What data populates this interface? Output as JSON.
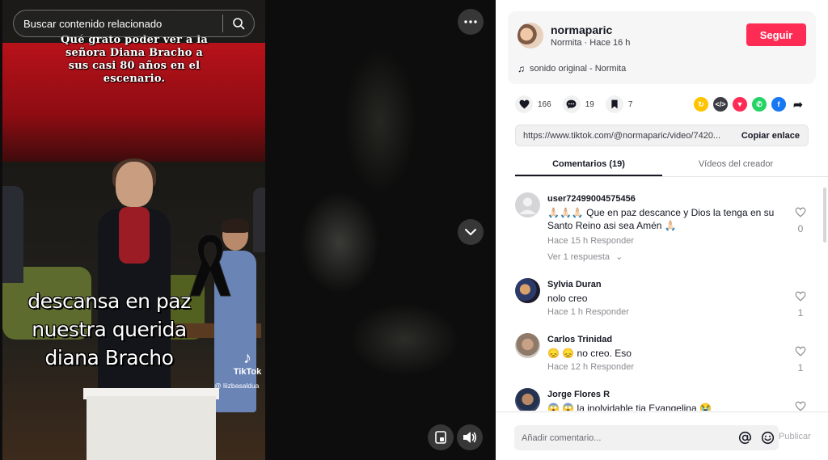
{
  "video": {
    "search_placeholder": "Buscar contenido relacionado",
    "caption_top": "Qué grato poder ver a la señora Diana Bracho a sus casi 80 años en el escenario.",
    "caption_main": "descansa en paz nuestra querida diana Bracho",
    "watermark_brand": "TikTok",
    "watermark_user": "@ liizbasaldua"
  },
  "creator": {
    "username": "normaparic",
    "subtitle": "Normita · Hace 16 h",
    "follow_label": "Seguir",
    "sound": "sonido original - Normita"
  },
  "actions": {
    "likes": "166",
    "comments": "19",
    "saves": "7"
  },
  "link": {
    "url": "https://www.tiktok.com/@normaparic/video/7420...",
    "copy_label": "Copiar enlace"
  },
  "tabs": [
    {
      "label": "Comentarios (19)"
    },
    {
      "label": "Vídeos del creador"
    }
  ],
  "comments": [
    {
      "user": "user72499004575456",
      "text": "🙏🏻🙏🏻🙏🏻 Que en paz descance y Dios la tenga en su Santo Reino asi sea Amén 🙏🏻",
      "meta": "Hace 15 h  Responder",
      "likes": "0",
      "replies": "Ver 1 respuesta"
    },
    {
      "user": "Sylvia Duran",
      "text": "nolo creo",
      "meta": "Hace 1 h    Responder",
      "likes": "1"
    },
    {
      "user": "Carlos Trinidad",
      "text": "😞 😞 no creo. Eso",
      "meta": "Hace 12 h  Responder",
      "likes": "1"
    },
    {
      "user": "Jorge Flores R",
      "text": "😱 😱 la inolvidable tia Evangelina 😭",
      "meta": "",
      "likes": ""
    }
  ],
  "composer": {
    "placeholder": "Añadir comentario...",
    "publish_label": "Publicar"
  },
  "colors": {
    "accent": "#fe2c55",
    "text": "#161823",
    "muted": "#8a8b91"
  }
}
